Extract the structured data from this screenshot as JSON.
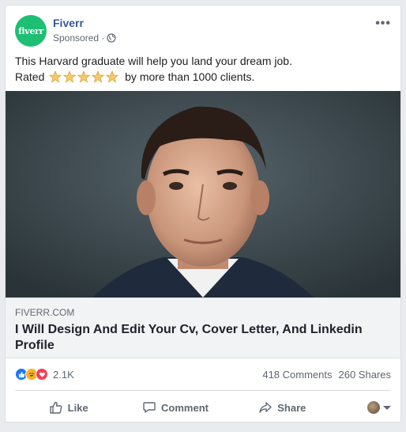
{
  "post": {
    "page_name": "Fiverr",
    "avatar_text": "fiverr",
    "sponsored": "Sponsored ·",
    "text_line1": "This Harvard graduate will help you land your dream job.",
    "text_line2_before": "Rated",
    "text_line2_after": "by more than 1000 clients.",
    "star_rating": 5,
    "more_icon": "•••"
  },
  "link": {
    "domain": "FIVERR.COM",
    "title": "I Will Design And Edit Your Cv, Cover Letter, And Linkedin Profile"
  },
  "stats": {
    "reactions_count": "2.1K",
    "comments": "418 Comments",
    "shares": "260 Shares"
  },
  "actions": {
    "like": "Like",
    "comment": "Comment",
    "share": "Share"
  },
  "colors": {
    "brand": "#1dbf73",
    "link": "#385898",
    "like": "#1877f2",
    "haha": "#f7b125",
    "love": "#f33e58"
  }
}
